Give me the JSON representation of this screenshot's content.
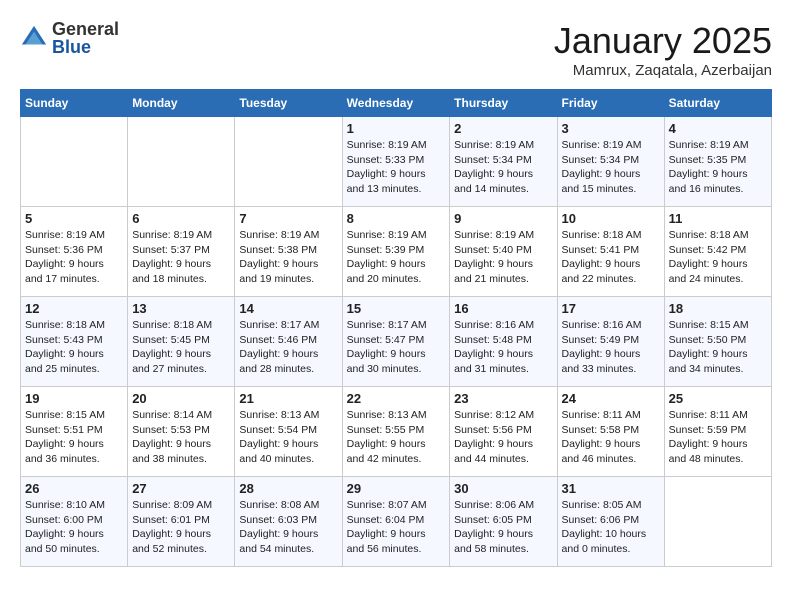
{
  "logo": {
    "general": "General",
    "blue": "Blue"
  },
  "title": "January 2025",
  "subtitle": "Mamrux, Zaqatala, Azerbaijan",
  "days_of_week": [
    "Sunday",
    "Monday",
    "Tuesday",
    "Wednesday",
    "Thursday",
    "Friday",
    "Saturday"
  ],
  "weeks": [
    [
      {
        "day": "",
        "info": ""
      },
      {
        "day": "",
        "info": ""
      },
      {
        "day": "",
        "info": ""
      },
      {
        "day": "1",
        "info": "Sunrise: 8:19 AM\nSunset: 5:33 PM\nDaylight: 9 hours\nand 13 minutes."
      },
      {
        "day": "2",
        "info": "Sunrise: 8:19 AM\nSunset: 5:34 PM\nDaylight: 9 hours\nand 14 minutes."
      },
      {
        "day": "3",
        "info": "Sunrise: 8:19 AM\nSunset: 5:34 PM\nDaylight: 9 hours\nand 15 minutes."
      },
      {
        "day": "4",
        "info": "Sunrise: 8:19 AM\nSunset: 5:35 PM\nDaylight: 9 hours\nand 16 minutes."
      }
    ],
    [
      {
        "day": "5",
        "info": "Sunrise: 8:19 AM\nSunset: 5:36 PM\nDaylight: 9 hours\nand 17 minutes."
      },
      {
        "day": "6",
        "info": "Sunrise: 8:19 AM\nSunset: 5:37 PM\nDaylight: 9 hours\nand 18 minutes."
      },
      {
        "day": "7",
        "info": "Sunrise: 8:19 AM\nSunset: 5:38 PM\nDaylight: 9 hours\nand 19 minutes."
      },
      {
        "day": "8",
        "info": "Sunrise: 8:19 AM\nSunset: 5:39 PM\nDaylight: 9 hours\nand 20 minutes."
      },
      {
        "day": "9",
        "info": "Sunrise: 8:19 AM\nSunset: 5:40 PM\nDaylight: 9 hours\nand 21 minutes."
      },
      {
        "day": "10",
        "info": "Sunrise: 8:18 AM\nSunset: 5:41 PM\nDaylight: 9 hours\nand 22 minutes."
      },
      {
        "day": "11",
        "info": "Sunrise: 8:18 AM\nSunset: 5:42 PM\nDaylight: 9 hours\nand 24 minutes."
      }
    ],
    [
      {
        "day": "12",
        "info": "Sunrise: 8:18 AM\nSunset: 5:43 PM\nDaylight: 9 hours\nand 25 minutes."
      },
      {
        "day": "13",
        "info": "Sunrise: 8:18 AM\nSunset: 5:45 PM\nDaylight: 9 hours\nand 27 minutes."
      },
      {
        "day": "14",
        "info": "Sunrise: 8:17 AM\nSunset: 5:46 PM\nDaylight: 9 hours\nand 28 minutes."
      },
      {
        "day": "15",
        "info": "Sunrise: 8:17 AM\nSunset: 5:47 PM\nDaylight: 9 hours\nand 30 minutes."
      },
      {
        "day": "16",
        "info": "Sunrise: 8:16 AM\nSunset: 5:48 PM\nDaylight: 9 hours\nand 31 minutes."
      },
      {
        "day": "17",
        "info": "Sunrise: 8:16 AM\nSunset: 5:49 PM\nDaylight: 9 hours\nand 33 minutes."
      },
      {
        "day": "18",
        "info": "Sunrise: 8:15 AM\nSunset: 5:50 PM\nDaylight: 9 hours\nand 34 minutes."
      }
    ],
    [
      {
        "day": "19",
        "info": "Sunrise: 8:15 AM\nSunset: 5:51 PM\nDaylight: 9 hours\nand 36 minutes."
      },
      {
        "day": "20",
        "info": "Sunrise: 8:14 AM\nSunset: 5:53 PM\nDaylight: 9 hours\nand 38 minutes."
      },
      {
        "day": "21",
        "info": "Sunrise: 8:13 AM\nSunset: 5:54 PM\nDaylight: 9 hours\nand 40 minutes."
      },
      {
        "day": "22",
        "info": "Sunrise: 8:13 AM\nSunset: 5:55 PM\nDaylight: 9 hours\nand 42 minutes."
      },
      {
        "day": "23",
        "info": "Sunrise: 8:12 AM\nSunset: 5:56 PM\nDaylight: 9 hours\nand 44 minutes."
      },
      {
        "day": "24",
        "info": "Sunrise: 8:11 AM\nSunset: 5:58 PM\nDaylight: 9 hours\nand 46 minutes."
      },
      {
        "day": "25",
        "info": "Sunrise: 8:11 AM\nSunset: 5:59 PM\nDaylight: 9 hours\nand 48 minutes."
      }
    ],
    [
      {
        "day": "26",
        "info": "Sunrise: 8:10 AM\nSunset: 6:00 PM\nDaylight: 9 hours\nand 50 minutes."
      },
      {
        "day": "27",
        "info": "Sunrise: 8:09 AM\nSunset: 6:01 PM\nDaylight: 9 hours\nand 52 minutes."
      },
      {
        "day": "28",
        "info": "Sunrise: 8:08 AM\nSunset: 6:03 PM\nDaylight: 9 hours\nand 54 minutes."
      },
      {
        "day": "29",
        "info": "Sunrise: 8:07 AM\nSunset: 6:04 PM\nDaylight: 9 hours\nand 56 minutes."
      },
      {
        "day": "30",
        "info": "Sunrise: 8:06 AM\nSunset: 6:05 PM\nDaylight: 9 hours\nand 58 minutes."
      },
      {
        "day": "31",
        "info": "Sunrise: 8:05 AM\nSunset: 6:06 PM\nDaylight: 10 hours\nand 0 minutes."
      },
      {
        "day": "",
        "info": ""
      }
    ]
  ]
}
